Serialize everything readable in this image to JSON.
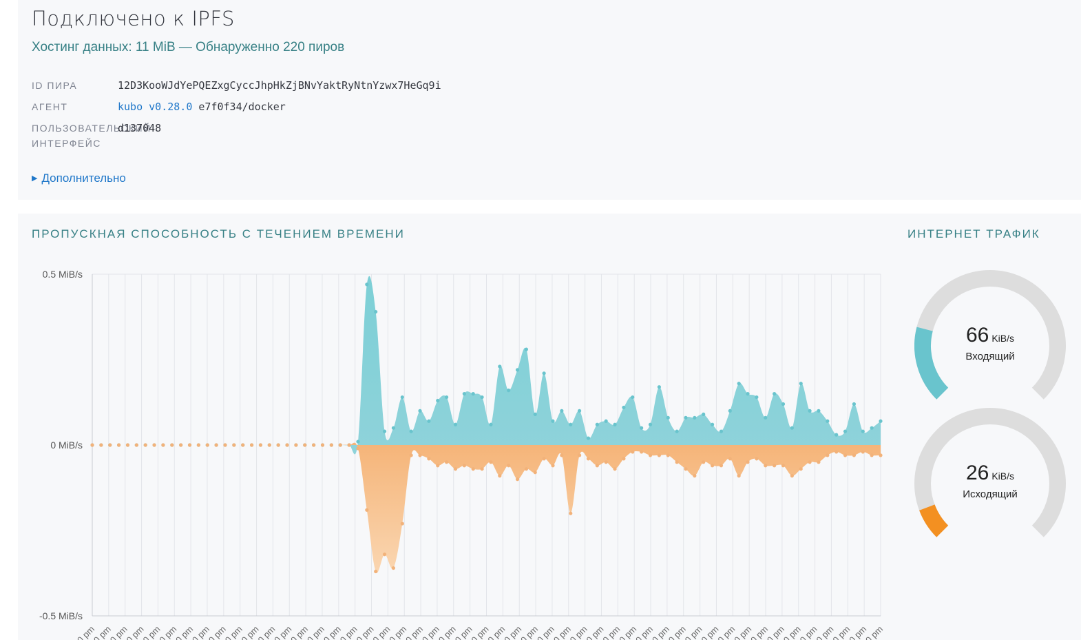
{
  "status": {
    "title": "Подключено к IPFS",
    "subtitle": "Хостинг данных: 11 MiB — Обнаруженно 220 пиров"
  },
  "info": {
    "peer_id_label": "ID ПИРА",
    "peer_id_value": "12D3KooWJdYePQEZxgCyccJhpHkZjBNvYaktRyNtnYzwx7HeGq9i",
    "agent_label": "АГЕНТ",
    "agent_link": "kubo v0.28.0",
    "agent_rest": " e7f0f34/docker",
    "ui_label_line1": "ПОЛЬЗОВАТЕЛЬСКИЙ",
    "ui_label_line2": "ИНТЕРФЕЙС",
    "ui_value": "d137048"
  },
  "advanced_label": "Дополнительно",
  "bandwidth": {
    "title": "ПРОПУСКНАЯ СПОСОБНОСТЬ С ТЕЧЕНИЕМ ВРЕМЕНИ",
    "traffic_title": "ИНТЕРНЕТ ТРАФИК"
  },
  "gauges": {
    "incoming": {
      "value": "66",
      "unit": "KiB/s",
      "label": "Входящий",
      "fraction": 0.22,
      "color": "#69c4cd"
    },
    "outgoing": {
      "value": "26",
      "unit": "KiB/s",
      "label": "Исходящий",
      "fraction": 0.09,
      "color": "#f39021"
    }
  },
  "chart_data": {
    "type": "area",
    "y_unit": "MiB/s",
    "y_ticks": [
      "0.5 MiB/s",
      "0 MiB/s",
      "-0.5 MiB/s"
    ],
    "ylim": [
      -0.5,
      0.5
    ],
    "x_tick_label": "pm",
    "colors": {
      "in": "#69c4cd",
      "out": "#f5b97f"
    },
    "series": [
      {
        "name": "in",
        "values": [
          0,
          0,
          0,
          0,
          0,
          0,
          0,
          0,
          0,
          0,
          0,
          0,
          0,
          0,
          0,
          0,
          0,
          0,
          0,
          0,
          0,
          0,
          0,
          0,
          0,
          0,
          0,
          0,
          0,
          0,
          0.01,
          0.47,
          0.39,
          0.04,
          0.05,
          0.14,
          0.04,
          0.1,
          0.07,
          0.13,
          0.14,
          0.06,
          0.15,
          0.15,
          0.14,
          0.06,
          0.23,
          0.16,
          0.22,
          0.28,
          0.09,
          0.21,
          0.07,
          0.1,
          0.06,
          0.1,
          0.02,
          0.06,
          0.07,
          0.06,
          0.11,
          0.14,
          0.05,
          0.06,
          0.17,
          0.08,
          0.04,
          0.08,
          0.08,
          0.09,
          0.06,
          0.04,
          0.1,
          0.18,
          0.15,
          0.14,
          0.08,
          0.15,
          0.12,
          0.05,
          0.18,
          0.1,
          0.1,
          0.07,
          0.03,
          0.04,
          0.12,
          0.04,
          0.05,
          0.07
        ]
      },
      {
        "name": "out",
        "values": [
          0,
          0,
          0,
          0,
          0,
          0,
          0,
          0,
          0,
          0,
          0,
          0,
          0,
          0,
          0,
          0,
          0,
          0,
          0,
          0,
          0,
          0,
          0,
          0,
          0,
          0,
          0,
          0,
          0,
          0,
          -0.01,
          -0.19,
          -0.37,
          -0.32,
          -0.36,
          -0.23,
          -0.03,
          -0.03,
          -0.04,
          -0.06,
          -0.05,
          -0.07,
          -0.06,
          -0.07,
          -0.07,
          -0.05,
          -0.09,
          -0.06,
          -0.1,
          -0.07,
          -0.08,
          -0.04,
          -0.06,
          -0.03,
          -0.2,
          -0.03,
          -0.04,
          -0.06,
          -0.05,
          -0.07,
          -0.04,
          -0.02,
          -0.02,
          -0.03,
          -0.03,
          -0.03,
          -0.05,
          -0.07,
          -0.09,
          -0.05,
          -0.06,
          -0.06,
          -0.04,
          -0.09,
          -0.05,
          -0.04,
          -0.06,
          -0.06,
          -0.06,
          -0.09,
          -0.07,
          -0.05,
          -0.05,
          -0.03,
          -0.02,
          -0.03,
          -0.03,
          -0.02,
          -0.03,
          -0.03
        ]
      }
    ]
  }
}
